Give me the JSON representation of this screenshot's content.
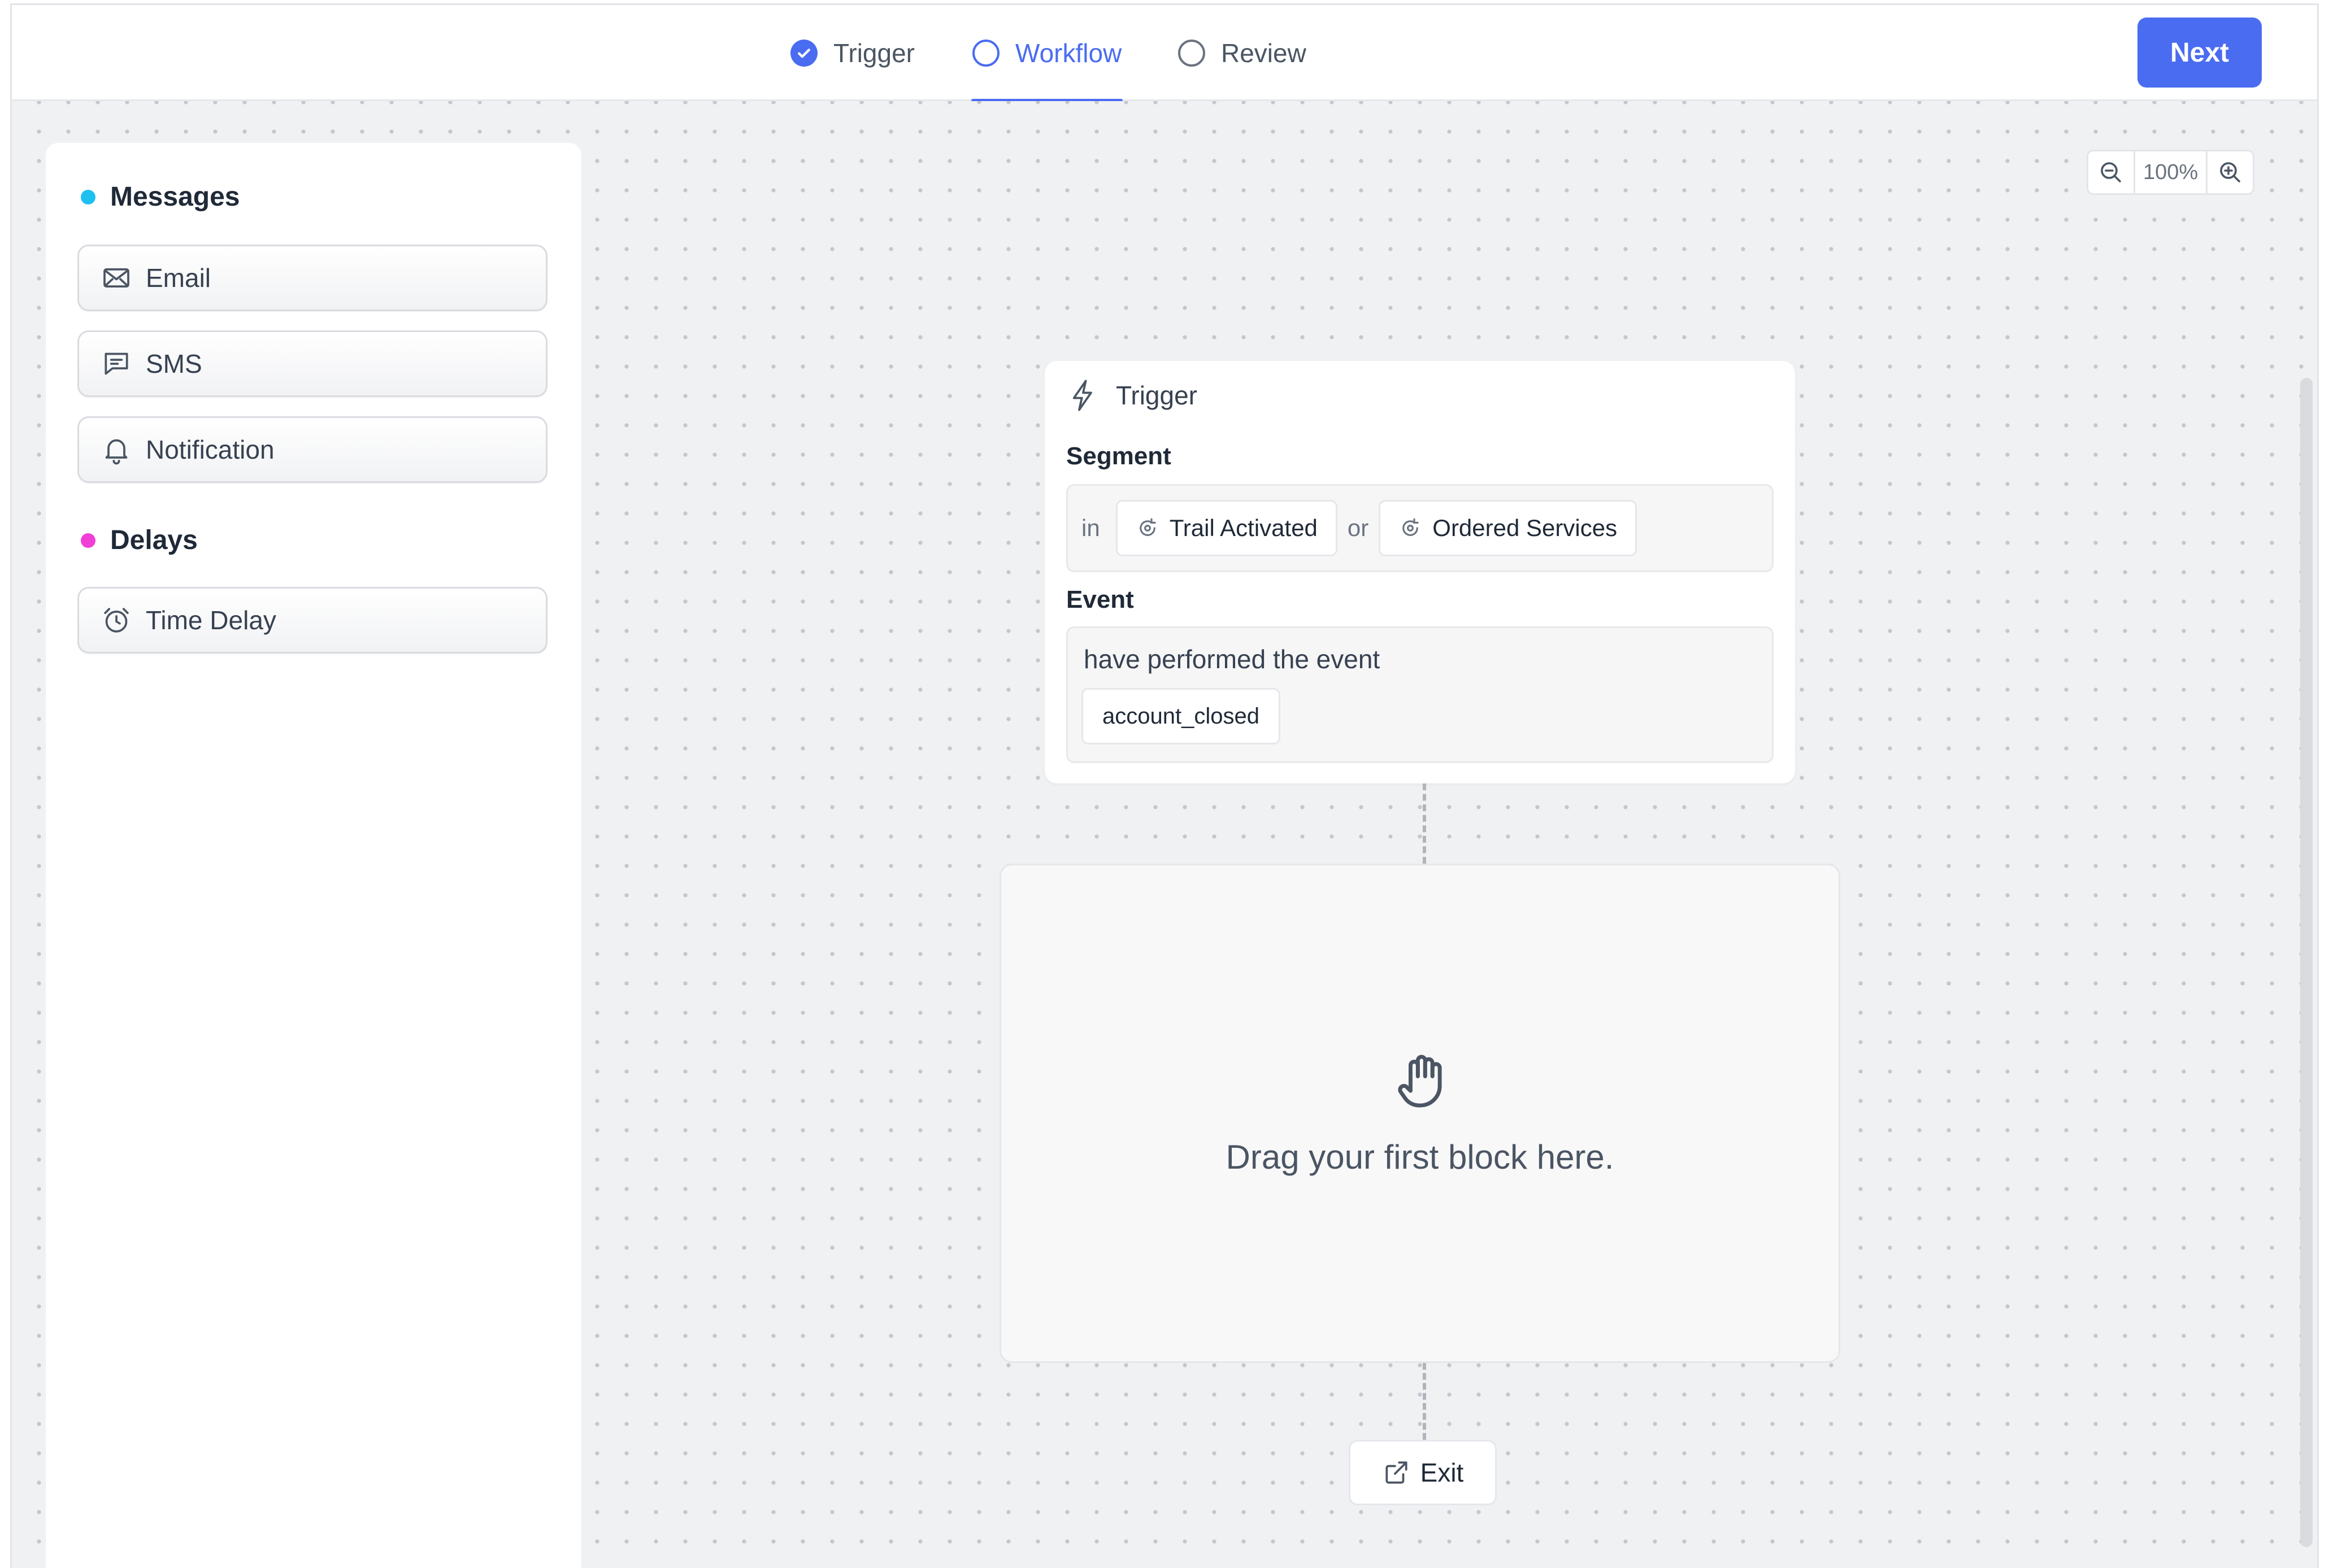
{
  "steps": {
    "trigger": {
      "label": "Trigger",
      "state": "complete"
    },
    "workflow": {
      "label": "Workflow",
      "state": "active"
    },
    "review": {
      "label": "Review",
      "state": "pending"
    }
  },
  "header": {
    "next_label": "Next"
  },
  "palette": {
    "messages": {
      "title": "Messages",
      "dot_color": "#1ec0f0",
      "items": [
        {
          "label": "Email",
          "icon": "mail-icon"
        },
        {
          "label": "SMS",
          "icon": "chat-icon"
        },
        {
          "label": "Notification",
          "icon": "bell-icon"
        }
      ]
    },
    "delays": {
      "title": "Delays",
      "dot_color": "#f03fd6",
      "items": [
        {
          "label": "Time Delay",
          "icon": "alarm-clock-icon"
        }
      ]
    }
  },
  "zoom": {
    "value": "100%"
  },
  "trigger_card": {
    "title": "Trigger",
    "segment_label": "Segment",
    "segment_prefix": "in",
    "segments": [
      "Trail Activated",
      "Ordered Services"
    ],
    "segment_joiner": "or",
    "event_label": "Event",
    "event_text": "have performed the event",
    "event_name": "account_closed"
  },
  "dropzone": {
    "text": "Drag your first block here."
  },
  "exit": {
    "label": "Exit"
  },
  "colors": {
    "accent": "#4a6cf0"
  }
}
